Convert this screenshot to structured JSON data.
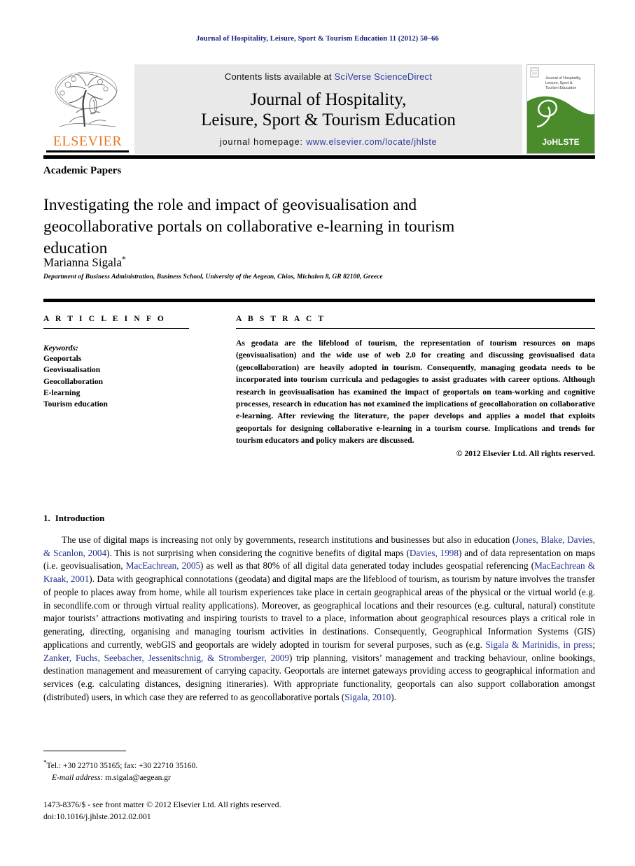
{
  "running_head": "Journal of Hospitality, Leisure, Sport & Tourism Education 11 (2012) 50–66",
  "masthead": {
    "publisher_name": "ELSEVIER",
    "contents_prefix": "Contents lists available at ",
    "contents_link": "SciVerse ScienceDirect",
    "journal_title_line1": "Journal of Hospitality,",
    "journal_title_line2": "Leisure, Sport & Tourism Education",
    "homepage_prefix": "journal homepage: ",
    "homepage_url": "www.elsevier.com/locate/jhlste",
    "cover": {
      "title_line1": "Journal of Hospitality,",
      "title_line2": "Leisure, Sport &",
      "title_line3": "Tourism Education",
      "acronym": "JoHLSTE",
      "green": "#4a8b2c"
    },
    "accent_orange": "#e87722",
    "link_blue": "#2b3b9e",
    "banner_gray": "#e9e9e9"
  },
  "article": {
    "section_label": "Academic Papers",
    "title": "Investigating the role and impact of geovisualisation and geocollaborative portals on collaborative e-learning in tourism education",
    "author": "Marianna Sigala",
    "author_marker": "*",
    "affiliation": "Department of Business Administration, Business School, University of the Aegean, Chios, Michalon 8, GR 82100, Greece"
  },
  "article_info": {
    "heading": "A R T I C L E   I N F O",
    "keywords_label": "Keywords:",
    "keywords": [
      "Geoportals",
      "Geovisualisation",
      "Geocollaboration",
      "E-learning",
      "Tourism education"
    ]
  },
  "abstract": {
    "heading": "A B S T R A C T",
    "text": "As geodata are the lifeblood of tourism, the representation of tourism resources on maps (geovisualisation) and the wide use of web 2.0 for creating and discussing geovisualised data (geocollaboration) are heavily adopted in tourism. Consequently, managing geodata needs to be incorporated into tourism curricula and pedagogies to assist graduates with career options. Although research in geovisualisation has examined the impact of geoportals on team-working and cognitive processes, research in education has not examined the implications of geocollaboration on collaborative e-learning. After reviewing the literature, the paper develops and applies a model that exploits geoportals for designing collaborative e-learning in a tourism course. Implications and trends for tourism educators and policy makers are discussed.",
    "copyright": "© 2012 Elsevier Ltd. All rights reserved."
  },
  "introduction": {
    "number": "1.",
    "heading": "Introduction",
    "paragraph_parts": [
      {
        "type": "text",
        "value": "The use of digital maps is increasing not only by governments, research institutions and businesses but also in education ("
      },
      {
        "type": "cite",
        "value": "Jones, Blake, Davies, & Scanlon, 2004"
      },
      {
        "type": "text",
        "value": "). This is not surprising when considering the cognitive benefits of digital maps ("
      },
      {
        "type": "cite",
        "value": "Davies, 1998"
      },
      {
        "type": "text",
        "value": ") and of data representation on maps (i.e. geovisualisation, "
      },
      {
        "type": "cite",
        "value": "MacEachrean, 2005"
      },
      {
        "type": "text",
        "value": ") as well as that 80% of all digital data generated today includes geospatial referencing ("
      },
      {
        "type": "cite",
        "value": "MacEachrean & Kraak, 2001"
      },
      {
        "type": "text",
        "value": "). Data with geographical connotations (geodata) and digital maps are the lifeblood of tourism, as tourism by nature involves the transfer of people to places away from home, while all tourism experiences take place in certain geographical areas of the physical or the virtual world (e.g. in secondlife.com or through virtual reality applications). Moreover, as geographical locations and their resources (e.g. cultural, natural) constitute major tourists’ attractions motivating and inspiring tourists to travel to a place, information about geographical resources plays a critical role in generating, directing, organising and managing tourism activities in destinations. Consequently, Geographical Information Systems (GIS) applications and currently, webGIS and geoportals are widely adopted in tourism for several purposes, such as (e.g. "
      },
      {
        "type": "cite",
        "value": "Sigala & Marinidis, in press"
      },
      {
        "type": "text",
        "value": "; "
      },
      {
        "type": "cite",
        "value": "Zanker, Fuchs, Seebacher, Jessenitschnig, & Stromberger, 2009"
      },
      {
        "type": "text",
        "value": ") trip planning, visitors’ management and tracking behaviour, online bookings, destination management and measurement of carrying capacity. Geoportals are internet gateways providing access to geographical information and services (e.g. calculating distances, designing itineraries). With appropriate functionality, geoportals can also support collaboration amongst (distributed) users, in which case they are referred to as geocollaborative portals ("
      },
      {
        "type": "cite",
        "value": "Sigala, 2010"
      },
      {
        "type": "text",
        "value": ")."
      }
    ]
  },
  "footnotes": {
    "tel": "Tel.: +30 22710 35165; fax: +30 22710 35160.",
    "email_label": "E-mail address:",
    "email": "m.sigala@aegean.gr",
    "issn_line": "1473-8376/$ - see front matter © 2012 Elsevier Ltd. All rights reserved.",
    "doi_line": "doi:10.1016/j.jhlste.2012.02.001"
  }
}
